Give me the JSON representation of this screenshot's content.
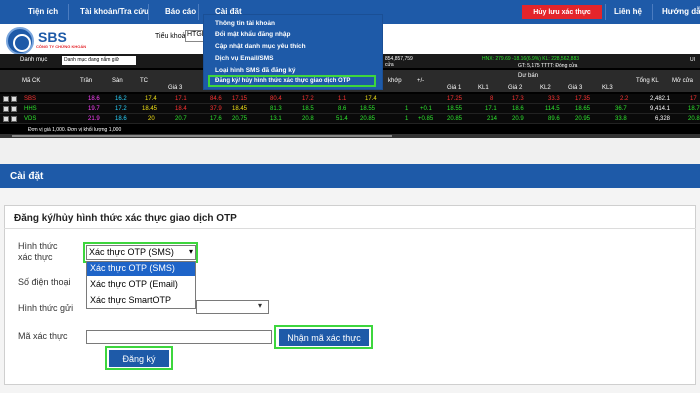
{
  "topnav": {
    "items": [
      "Tiện ích",
      "Tài khoản/Tra cứu",
      "Báo cáo",
      "Cài đặt",
      "Liên hệ",
      "Hướng dẫn"
    ],
    "cancel_otp": "Hủy lưu xác thực"
  },
  "header": {
    "logo": "SBS",
    "logo_sub": "CÔNG TY CHỨNG KHOÁN",
    "account_label": "Tiểu khoản",
    "account_value": "HTGD"
  },
  "menu": {
    "items": [
      "Thông tin tài khoản",
      "Đổi mật khẩu đăng nhập",
      "Cập nhật danh mục yêu thích",
      "Dịch vụ Email/SMS",
      "Loại hình SMS đã đăng ký",
      "Đăng ký/ hủy hình thức xác thực giao dịch OTP"
    ]
  },
  "board": {
    "dm_label": "Danh mục",
    "dm_value": "Danh mục đang nắm giữ",
    "hnx_line": "HNX: 279.69 -18.16(6.9%)  KL: 228,562,883",
    "hnx_line2": "GT: 5,175  TTTT: Đóng cửa",
    "left_idx": "854,857,759",
    "left_idx2": "cửa",
    "right_tag": "UI",
    "col_headers": {
      "ma_ck": "Mã CK",
      "tran": "Trần",
      "san": "Sàn",
      "tc": "TC",
      "gia3": "Giá 3",
      "khop": "khớp",
      "plusminus": "+/-",
      "du_ban": "Dư bán",
      "gia1": "Giá 1",
      "kl1": "KL1",
      "gia2": "Giá 2",
      "kl2": "KL2",
      "gia3b": "Giá 3",
      "kl3": "KL3",
      "tong_kl": "Tổng KL",
      "mo_cua": "Mở cửa"
    },
    "rows": [
      {
        "code": "SBS",
        "tran": "18.6",
        "san": "16.2",
        "tc": "17.4",
        "a": "17.1",
        "b": "84.6",
        "c": "17.15",
        "d": "80.4",
        "e": "17.2",
        "f": "1.1",
        "g": "17.4",
        "h": "",
        "i": "",
        "j": "17.25",
        "k": "8",
        "l": "17.3",
        "m": "33.3",
        "n": "17.35",
        "o": "2.2",
        "p": "2,482.1",
        "q": "17"
      },
      {
        "code": "HHS",
        "tran": "19.7",
        "san": "17.2",
        "tc": "18.45",
        "a": "18.4",
        "b": "37.9",
        "c": "18.45",
        "d": "81.3",
        "e": "18.5",
        "f": "8.6",
        "g": "18.55",
        "h": "1",
        "i": "+0.1",
        "j": "18.55",
        "k": "17.1",
        "l": "18.6",
        "m": "114.5",
        "n": "18.65",
        "o": "36.7",
        "p": "9,414.1",
        "q": "18.7"
      },
      {
        "code": "VDS",
        "tran": "21.9",
        "san": "18.6",
        "tc": "20",
        "a": "20.7",
        "b": "17.6",
        "c": "20.75",
        "d": "13.1",
        "e": "20.8",
        "f": "51.4",
        "g": "20.85",
        "h": "1",
        "i": "+0.85",
        "j": "20.85",
        "k": "214",
        "l": "20.9",
        "m": "89.6",
        "n": "20.95",
        "o": "33.8",
        "p": "6,328",
        "q": "20.8"
      }
    ],
    "note": "Đơn vị giá 1,000.  Đơn vị khối lượng 1,000"
  },
  "settings": {
    "bar_title": "Cài đặt",
    "panel_title": "Đăng ký/hủy hình thức xác thực giao dịch OTP",
    "label_method_1": "Hình thức",
    "label_method_2": "xác thực",
    "label_phone": "Số điện thoại",
    "label_send": "Hình thức gửi",
    "label_code": "Mã xác thực",
    "selected_method": "Xác thực OTP (SMS)",
    "options": [
      "Xác thực OTP (SMS)",
      "Xác thực OTP (Email)",
      "Xác thực SmartOTP"
    ],
    "get_code": "Nhận mã xác thực",
    "register": "Đăng ký"
  },
  "colors": {
    "brand_blue": "#1e5aa8",
    "highlight_green": "#3dd63d",
    "cancel_red": "#e4252b"
  }
}
